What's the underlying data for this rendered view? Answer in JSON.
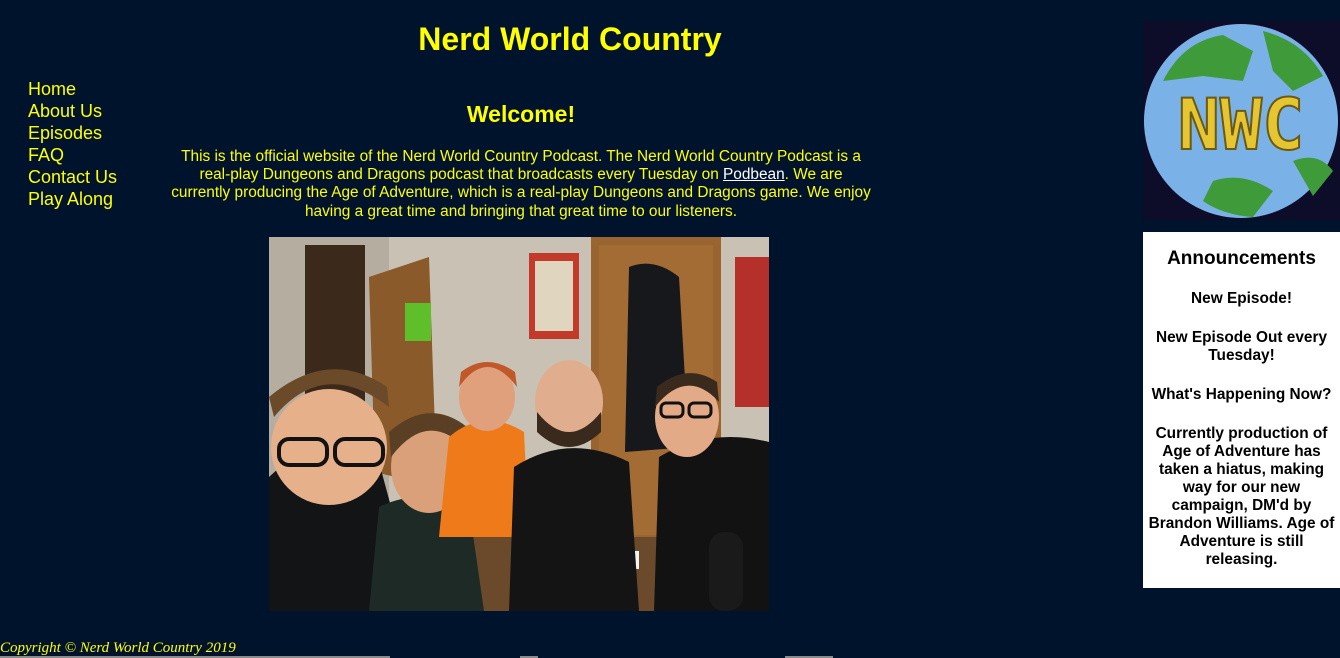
{
  "site": {
    "title": "Nerd World Country"
  },
  "nav": {
    "items": [
      {
        "label": "Home"
      },
      {
        "label": "About Us"
      },
      {
        "label": "Episodes"
      },
      {
        "label": "FAQ"
      },
      {
        "label": "Contact Us"
      },
      {
        "label": "Play Along"
      }
    ]
  },
  "main": {
    "heading": "Welcome!",
    "intro_before_link": "This is the official website of the Nerd World Country Podcast. The Nerd World Country Podcast is a real-play Dungeons and Dragons podcast that broadcasts every Tuesday on ",
    "intro_link": "Podbean",
    "intro_after_link": ". We are currently producing the Age of Adventure, which is a real-play Dungeons and Dragons game. We enjoy having a great time and bringing that great time to our listeners."
  },
  "logo": {
    "text": "NWC"
  },
  "announcements": {
    "heading": "Announcements",
    "items": [
      "New Episode!",
      "New Episode Out every Tuesday!",
      "What's Happening Now?",
      "Currently production of Age of Adventure has taken a hiatus, making way for our new campaign, DM'd by Brandon Williams. Age of Adventure is still releasing."
    ]
  },
  "footer": {
    "copyright": "Copyright © Nerd World Country 2019"
  },
  "colors": {
    "background": "#00132d",
    "accent": "#ffff00",
    "link": "#ffffff",
    "panel": "#ffffff"
  }
}
